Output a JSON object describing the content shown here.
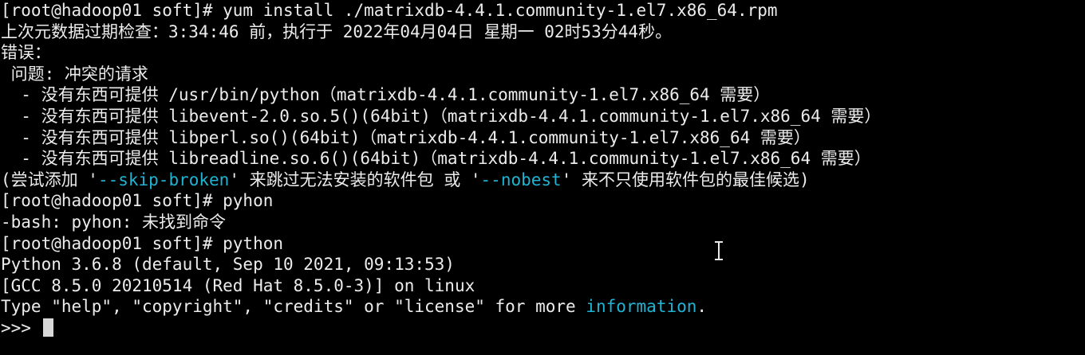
{
  "colors": {
    "background": "#000000",
    "foreground": "#ececec",
    "highlight": "#1fb3d4",
    "cursor": "#d8d8d8"
  },
  "lines": [
    {
      "segments": [
        {
          "text": "[root@hadoop01 soft]# yum install ./matrixdb-4.4.1.community-1.el7.x86_64.rpm"
        }
      ]
    },
    {
      "segments": [
        {
          "text": "上次元数据过期检查：3:34:46 前，执行于 2022年04月04日 星期一 02时53分44秒。"
        }
      ]
    },
    {
      "segments": [
        {
          "text": "错误："
        }
      ]
    },
    {
      "segments": [
        {
          "text": " 问题: 冲突的请求"
        }
      ]
    },
    {
      "segments": [
        {
          "text": "  - 没有东西可提供 /usr/bin/python（matrixdb-4.4.1.community-1.el7.x86_64 需要）"
        }
      ]
    },
    {
      "segments": [
        {
          "text": "  - 没有东西可提供 libevent-2.0.so.5()(64bit)（matrixdb-4.4.1.community-1.el7.x86_64 需要）"
        }
      ]
    },
    {
      "segments": [
        {
          "text": "  - 没有东西可提供 libperl.so()(64bit)（matrixdb-4.4.1.community-1.el7.x86_64 需要）"
        }
      ]
    },
    {
      "segments": [
        {
          "text": "  - 没有东西可提供 libreadline.so.6()(64bit)（matrixdb-4.4.1.community-1.el7.x86_64 需要）"
        }
      ]
    },
    {
      "segments": [
        {
          "text": "(尝试添加 '"
        },
        {
          "text": "--skip-broken",
          "highlight": true
        },
        {
          "text": "' 来跳过无法安装的软件包 或 '"
        },
        {
          "text": "--nobest",
          "highlight": true
        },
        {
          "text": "' 来不只使用软件包的最佳候选)"
        }
      ]
    },
    {
      "segments": [
        {
          "text": "[root@hadoop01 soft]# pyhon"
        }
      ]
    },
    {
      "segments": [
        {
          "text": "-bash: pyhon: 未找到命令"
        }
      ]
    },
    {
      "segments": [
        {
          "text": "[root@hadoop01 soft]# python"
        }
      ]
    },
    {
      "segments": [
        {
          "text": "Python 3.6.8 (default, Sep 10 2021, 09:13:53)"
        }
      ]
    },
    {
      "segments": [
        {
          "text": "[GCC 8.5.0 20210514 (Red Hat 8.5.0-3)] on linux"
        }
      ]
    },
    {
      "segments": [
        {
          "text": "Type \"help\", \"copyright\", \"credits\" or \"license\" for more "
        },
        {
          "text": "information",
          "highlight": true
        },
        {
          "text": "."
        }
      ]
    }
  ],
  "prompt": ">>> "
}
